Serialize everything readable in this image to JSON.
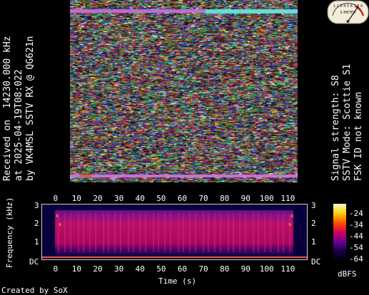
{
  "left_info": {
    "lines": [
      "Received on  14230.000 kHz",
      "at 2025-04-19T08:022",
      "by VK4MSL SSTV RX @ QG621n"
    ]
  },
  "right_info": {
    "lines": [
      "Signal strength: S8",
      "SSTV Mode: Scottie S1",
      "FSK ID not known"
    ]
  },
  "meter": {
    "icon": "s-meter-icon",
    "scale_text": "1 2 3 4 5 6 7 8 9",
    "label": "S-METER"
  },
  "spectrogram": {
    "ylabel": "Frequency (kHz)",
    "xlabel": "Time (s)",
    "x_ticks": [
      "0",
      "10",
      "20",
      "30",
      "40",
      "50",
      "60",
      "70",
      "80",
      "90",
      "100",
      "110"
    ],
    "y_ticks": [
      "3",
      "2",
      "1",
      "DC"
    ]
  },
  "colorbar": {
    "labels": [
      "-24",
      "-34",
      "-44",
      "-54",
      "-64"
    ],
    "unit": "dBFS",
    "colors": [
      "#fffbd0",
      "#ffd000",
      "#ff5000",
      "#d0005a",
      "#6a0090",
      "#14004a",
      "#000000"
    ]
  },
  "footer": {
    "created_by": "Created by SoX"
  }
}
